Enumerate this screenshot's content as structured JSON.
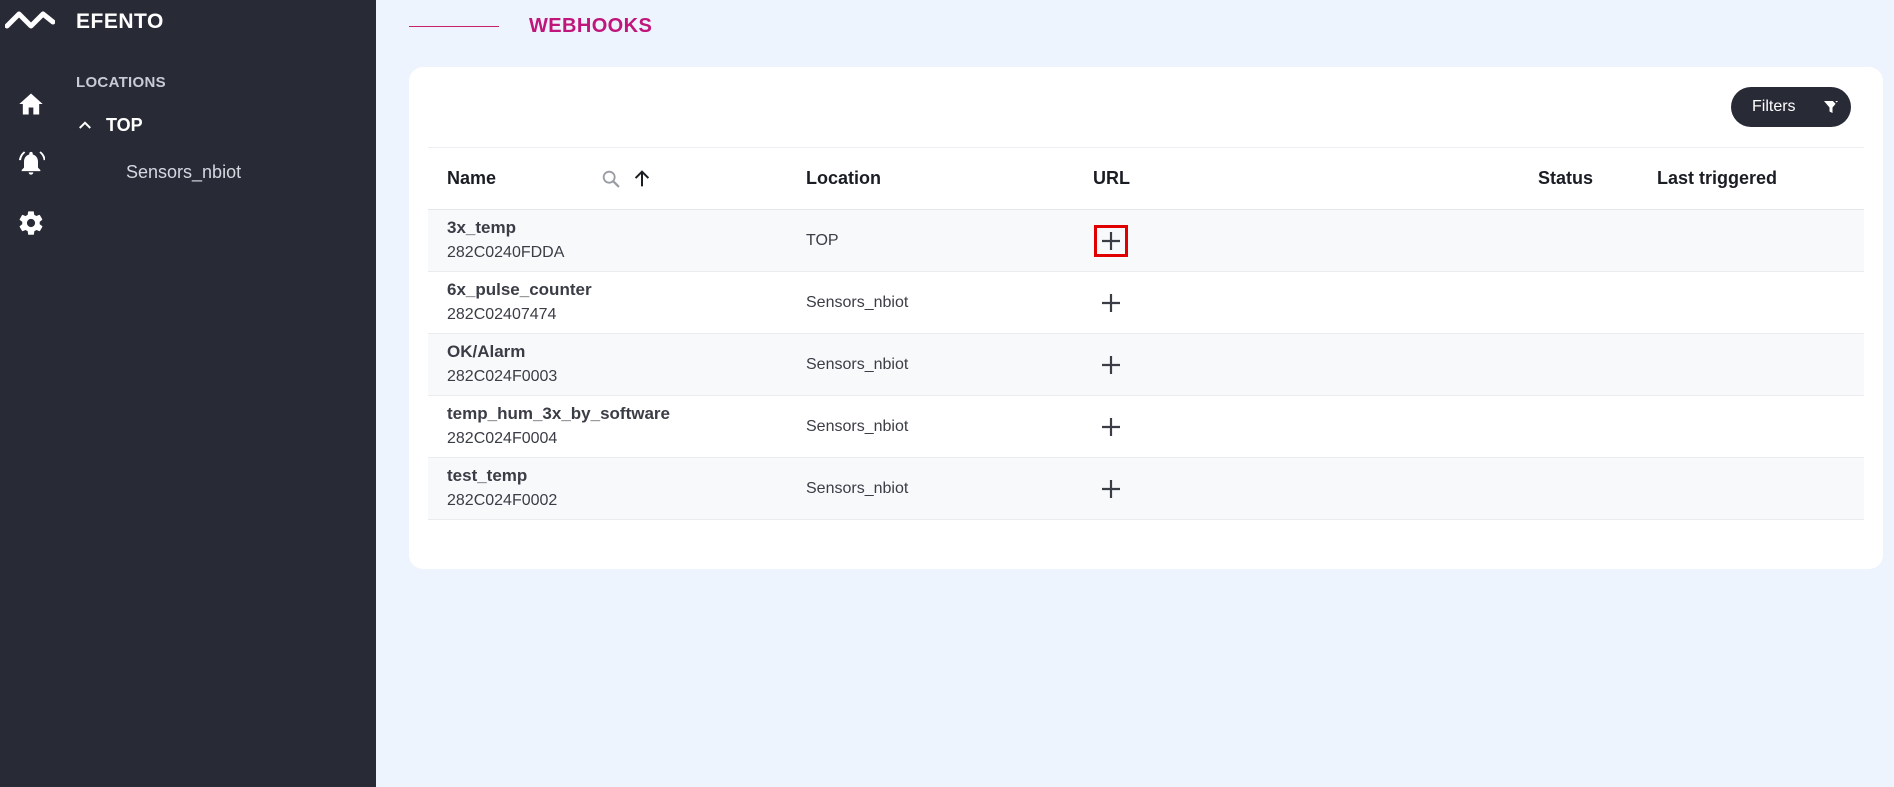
{
  "app": {
    "brand": "EFENTO"
  },
  "nav": {
    "icons": [
      "home-icon",
      "bell-alarm-icon",
      "gear-icon"
    ]
  },
  "sidebar": {
    "section_title": "LOCATIONS",
    "tree": {
      "root": "TOP",
      "expanded": true,
      "children": [
        "Sensors_nbiot"
      ]
    }
  },
  "page": {
    "title": "WEBHOOKS",
    "filters_label": "Filters"
  },
  "table": {
    "columns": {
      "name": "Name",
      "location": "Location",
      "url": "URL",
      "status": "Status",
      "last_triggered": "Last triggered"
    },
    "rows": [
      {
        "name": "3x_temp",
        "id": "282C0240FDDA",
        "location": "TOP",
        "url_action": "add",
        "highlighted": true
      },
      {
        "name": "6x_pulse_counter",
        "id": "282C02407474",
        "location": "Sensors_nbiot",
        "url_action": "add"
      },
      {
        "name": "OK/Alarm",
        "id": "282C024F0003",
        "location": "Sensors_nbiot",
        "url_action": "add"
      },
      {
        "name": "temp_hum_3x_by_software",
        "id": "282C024F0004",
        "location": "Sensors_nbiot",
        "url_action": "add"
      },
      {
        "name": "test_temp",
        "id": "282C024F0002",
        "location": "Sensors_nbiot",
        "url_action": "add"
      }
    ]
  },
  "colors": {
    "sidebar_bg": "#282a36",
    "page_bg": "#eef4fd",
    "accent": "#c0157a",
    "highlight": "#e00000"
  }
}
